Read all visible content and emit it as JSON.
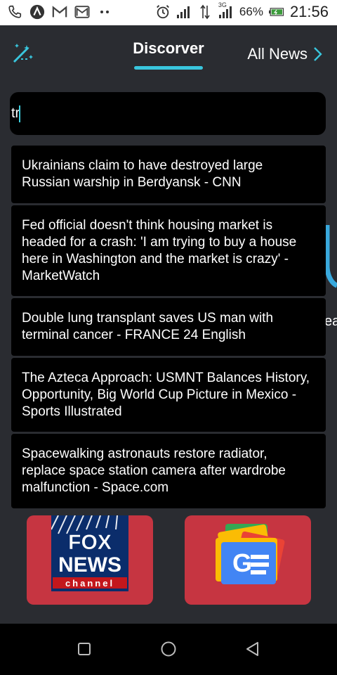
{
  "status_bar": {
    "battery_percent": "66%",
    "network_label": "3G",
    "time": "21:56",
    "icons": [
      "phone-icon",
      "a-logo-icon",
      "gmail-icon",
      "gmail-outline-icon",
      "more-dots-icon",
      "alarm-icon",
      "signal-icon",
      "data-arrows-icon",
      "signal-3g-icon",
      "battery-charging-icon"
    ]
  },
  "header": {
    "title": "Discorver",
    "all_news_label": "All News",
    "accent_color": "#39c6dd"
  },
  "search": {
    "value": "tr"
  },
  "suggestions": [
    {
      "text": "Ukrainians claim to have destroyed large Russian warship in Berdyansk - CNN"
    },
    {
      "text": "Fed official doesn't think housing market is headed for a crash: 'I am trying to buy a house here in Washington and the market is crazy' - MarketWatch"
    },
    {
      "text": "Double lung transplant saves US man with terminal cancer - FRANCE 24 English"
    },
    {
      "text": "The Azteca Approach: USMNT Balances History, Opportunity, Big World Cup Picture in Mexico - Sports Illustrated"
    },
    {
      "text": "Spacewalking astronauts restore radiator, replace space station camera after wardrobe malfunction - Space.com"
    }
  ],
  "background_peek": {
    "letter_fragment": "ea"
  },
  "tiles": [
    {
      "name": "Fox News",
      "logo_lines": [
        "FOX",
        "NEWS",
        "channel"
      ],
      "color": "#c63541"
    },
    {
      "name": "Google News",
      "logo_text": "G",
      "color": "#c63541"
    }
  ],
  "nav": {
    "icons": [
      "recents-square-icon",
      "home-circle-icon",
      "back-triangle-icon"
    ]
  }
}
